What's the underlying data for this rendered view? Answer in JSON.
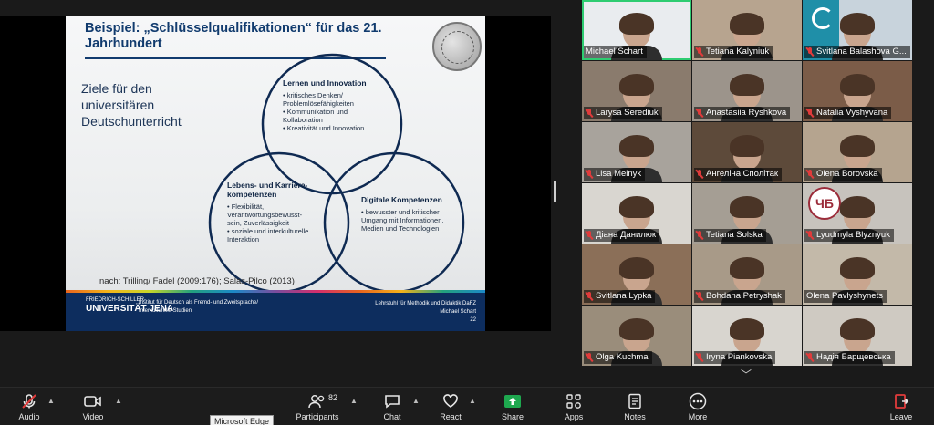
{
  "slide": {
    "title": "Beispiel: „Schlüsselqualifikationen“ für das 21. Jahrhundert",
    "goal_text": "Ziele für den universitären Deutschunterricht",
    "circles": [
      {
        "heading": "Lernen und Innovation",
        "bullets": [
          "• kritisches Denken/ Problemlösefähigkeiten",
          "• Kommunikation und Kollaboration",
          "• Kreativität und Innovation"
        ]
      },
      {
        "heading": "Lebens- und Karriere-kompetenzen",
        "bullets": [
          "• Flexibilität, Verantwortungsbewusst-sein, Zuverlässigkeit",
          "• soziale und interkulturelle Interaktion"
        ]
      },
      {
        "heading": "Digitale Kompetenzen",
        "bullets": [
          "• bewusster und kritischer Umgang mit Informationen, Medien und Technologien"
        ]
      }
    ],
    "citation": "nach: Trilling/ Fadel (2009:176); Salas-Pilco (2013)",
    "university_small": "FRIEDRICH-SCHILLER-",
    "university_big": "UNIVERSITÄT JENA",
    "institute": "Institut für Deutsch als Fremd- und Zweitsprache/ Interkulturelle Studien",
    "chair": "Lehrstuhl für Methodik und Didaktik DaFZ",
    "presenter": "Michael Schart",
    "page": "22"
  },
  "participants": [
    {
      "name": "Michael Schart",
      "muted": false,
      "active": true,
      "bg": "#e9ecef"
    },
    {
      "name": "Tetiana Kalyniuk",
      "muted": true,
      "bg": "#b7a48f"
    },
    {
      "name": "Svitlana Balashova  G...",
      "muted": true,
      "bg": "#c8d3dc"
    },
    {
      "name": "Larysa Serediuk",
      "muted": true,
      "bg": "#8a7b6d"
    },
    {
      "name": "Anastasiia Ryshkova",
      "muted": true,
      "bg": "#9c948b"
    },
    {
      "name": "Natalia Vyshyvana",
      "muted": true,
      "bg": "#7b5c48"
    },
    {
      "name": "Lisa Melnyk",
      "muted": true,
      "bg": "#a8a39c"
    },
    {
      "name": "Ангеліна Сполітак",
      "muted": true,
      "bg": "#5d4a3a"
    },
    {
      "name": "Olena Borovska",
      "muted": true,
      "bg": "#b5a48f"
    },
    {
      "name": "Діана Данилюк",
      "muted": true,
      "bg": "#d9d6d0"
    },
    {
      "name": "Tetiana Solska",
      "muted": true,
      "bg": "#a59e94"
    },
    {
      "name": "Lyudmyla Blyznyuk",
      "muted": true,
      "bg": "#c7c3bd"
    },
    {
      "name": "Svitlana Lypka",
      "muted": true,
      "bg": "#8b6f58"
    },
    {
      "name": "Bohdana Petryshak",
      "muted": true,
      "bg": "#a89a88"
    },
    {
      "name": "Olena Pavlyshynets",
      "muted": false,
      "bg": "#c3b9a9"
    },
    {
      "name": "Olga Kuchma",
      "muted": true,
      "bg": "#9a8d7b"
    },
    {
      "name": "Iryna Piankovska",
      "muted": true,
      "bg": "#d8d5cf"
    },
    {
      "name": "Надія Барщевська",
      "muted": true,
      "bg": "#cfcac2"
    }
  ],
  "toolbar": {
    "audio": "Audio",
    "video": "Video",
    "participants": "Participants",
    "participant_count": "82",
    "chat": "Chat",
    "react": "React",
    "share": "Share",
    "apps": "Apps",
    "notes": "Notes",
    "more": "More",
    "leave": "Leave"
  },
  "tooltip": "Microsoft Edge",
  "colors": {
    "accent_green": "#2ecc71",
    "share_green": "#1ea84f",
    "leave_red": "#e03b3b",
    "slide_navy": "#113b6e"
  }
}
